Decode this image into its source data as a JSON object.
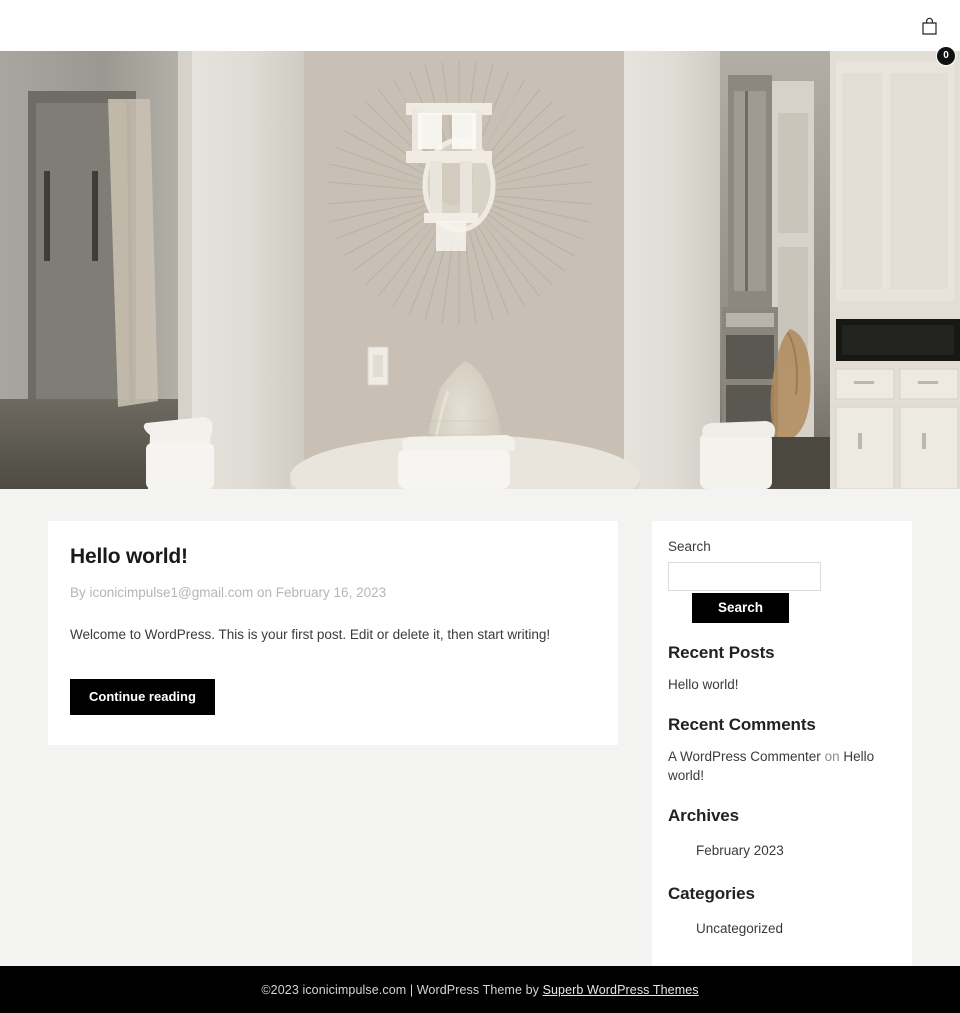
{
  "header": {
    "cart_icon": "shopping-bag-icon",
    "cart_count": "0"
  },
  "hero": {
    "alt": "dining room interior with sunburst mirror, glass vase on round marble table and white chairs"
  },
  "post": {
    "title": "Hello world!",
    "meta": "By iconicimpulse1@gmail.com on February 16, 2023",
    "excerpt": "Welcome to WordPress. This is your first post. Edit or delete it, then start writing!",
    "continue_label": "Continue reading"
  },
  "sidebar": {
    "search": {
      "label": "Search",
      "value": "",
      "button_label": "Search"
    },
    "recent_posts": {
      "title": "Recent Posts",
      "items": [
        "Hello world!"
      ]
    },
    "recent_comments": {
      "title": "Recent Comments",
      "author": "A WordPress Commenter",
      "connector": "on",
      "post": "Hello world!"
    },
    "archives": {
      "title": "Archives",
      "items": [
        "February 2023"
      ]
    },
    "categories": {
      "title": "Categories",
      "items": [
        "Uncategorized"
      ]
    }
  },
  "footer": {
    "copyright": "©2023 iconicimpulse.com | WordPress Theme by",
    "link": "Superb WordPress Themes"
  },
  "colors": {
    "page_background": "#f3f3f1",
    "card_background": "#ffffff",
    "accent_dark": "#000000",
    "footer_background": "#000000",
    "meta_text": "#b6b6b6"
  }
}
